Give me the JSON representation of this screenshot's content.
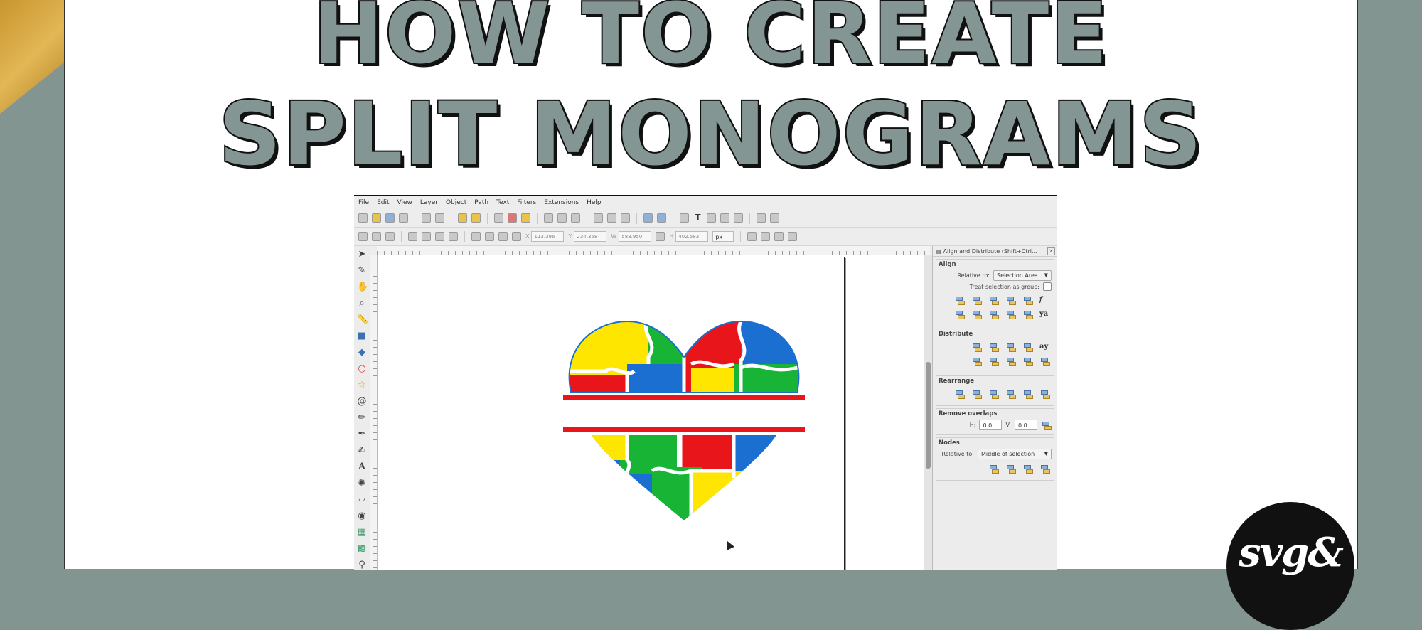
{
  "title": {
    "line1": "HOW TO CREATE",
    "line2": "SPLIT MONOGRAMS"
  },
  "colors": {
    "background": "#829591",
    "headline_fill": "#839693",
    "gold_corner": "#d3a645",
    "heart_red": "#e8151b",
    "heart_yellow": "#ffe600",
    "heart_green": "#18b435",
    "heart_blue": "#1a6fd1"
  },
  "inkscape": {
    "menu": [
      "File",
      "Edit",
      "View",
      "Layer",
      "Object",
      "Path",
      "Text",
      "Filters",
      "Extensions",
      "Help"
    ],
    "coords": [
      {
        "label": "X",
        "value": "113.396"
      },
      {
        "label": "Y",
        "value": "234.358"
      },
      {
        "label": "W",
        "value": "583.950"
      },
      {
        "label": "H",
        "value": "402.583"
      }
    ],
    "unit": "px",
    "dock": {
      "title": "Align and Distribute (Shift+Ctrl...",
      "align": {
        "heading": "Align",
        "relative_label": "Relative to:",
        "relative_value": "Selection Area",
        "treat_label": "Treat selection as group:"
      },
      "distribute": {
        "heading": "Distribute"
      },
      "rearrange": {
        "heading": "Rearrange"
      },
      "remove_overlaps": {
        "heading": "Remove overlaps",
        "h_label": "H:",
        "h_value": "0.0",
        "v_label": "V:",
        "v_value": "0.0"
      },
      "nodes": {
        "heading": "Nodes",
        "relative_label": "Relative to:",
        "relative_value": "Middle of selection"
      }
    },
    "tools": [
      "selector-icon",
      "node-icon",
      "tweak-icon",
      "zoom-icon",
      "measure-icon",
      "rect-icon",
      "3dbox-icon",
      "ellipse-icon",
      "star-icon",
      "spiral-icon",
      "pencil-icon",
      "pen-icon",
      "calligraphy-icon",
      "text-icon",
      "spray-icon",
      "eraser-icon",
      "bucket-icon",
      "gradient-icon",
      "mesh-icon",
      "dropper-icon"
    ],
    "text_tool_glyph": "A",
    "distribute_glyph": "ay",
    "align_glyph": "ya"
  },
  "badge": {
    "text": "svg&"
  }
}
